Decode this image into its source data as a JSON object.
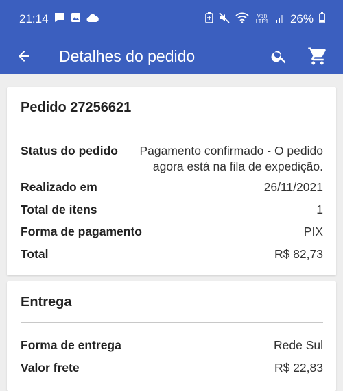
{
  "status_bar": {
    "time": "21:14",
    "battery": "26%",
    "network_label": "Vo)) LTE1"
  },
  "app_bar": {
    "title": "Detalhes do pedido"
  },
  "order": {
    "title": "Pedido 27256621",
    "rows": [
      {
        "label": "Status do pedido",
        "value_line1": "Pagamento confirmado - O pedido",
        "value_line2": "agora está na fila de expedição."
      },
      {
        "label": "Realizado em",
        "value": "26/11/2021"
      },
      {
        "label": "Total de itens",
        "value": "1"
      },
      {
        "label": "Forma de pagamento",
        "value": "PIX"
      },
      {
        "label": "Total",
        "value": "R$ 82,73"
      }
    ]
  },
  "delivery": {
    "title": "Entrega",
    "rows": [
      {
        "label": "Forma de entrega",
        "value": "Rede Sul"
      },
      {
        "label": "Valor frete",
        "value": "R$ 22,83"
      }
    ]
  },
  "colors": {
    "primary": "#3b5fbf",
    "background": "#eeeeee"
  }
}
